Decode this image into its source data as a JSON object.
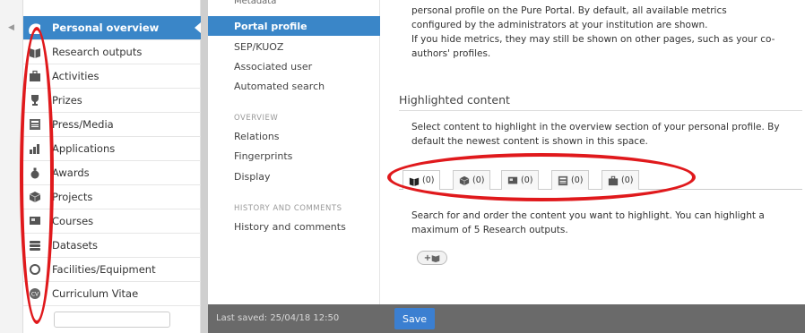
{
  "left_nav": {
    "items": [
      {
        "label": "Personal overview",
        "icon": "user-icon",
        "active": true
      },
      {
        "label": "Research outputs",
        "icon": "book-icon"
      },
      {
        "label": "Activities",
        "icon": "briefcase-icon"
      },
      {
        "label": "Prizes",
        "icon": "trophy-icon"
      },
      {
        "label": "Press/Media",
        "icon": "newspaper-icon"
      },
      {
        "label": "Applications",
        "icon": "bar-chart-icon"
      },
      {
        "label": "Awards",
        "icon": "money-bag-icon"
      },
      {
        "label": "Projects",
        "icon": "cube-icon"
      },
      {
        "label": "Courses",
        "icon": "presentation-icon"
      },
      {
        "label": "Datasets",
        "icon": "database-icon"
      },
      {
        "label": "Facilities/Equipment",
        "icon": "circle-icon"
      },
      {
        "label": "Curriculum Vitae",
        "icon": "cv-icon"
      }
    ]
  },
  "mid_nav": {
    "cut_top": "Metadata",
    "items": [
      {
        "label": "Portal profile",
        "active": true
      },
      {
        "label": "SEP/KUOZ"
      },
      {
        "label": "Associated user"
      },
      {
        "label": "Automated search"
      }
    ],
    "overview_heading": "OVERVIEW",
    "overview_items": [
      "Relations",
      "Fingerprints",
      "Display"
    ],
    "history_heading": "HISTORY AND COMMENTS",
    "history_items": [
      "History and comments"
    ]
  },
  "main": {
    "intro_lines": [
      "personal profile on the Pure Portal. By default, all available metrics",
      "configured by the administrators at your institution are shown.",
      "If you hide metrics, they may still be shown on other pages, such as your co-",
      "authors' profiles."
    ],
    "highlighted_title": "Highlighted content",
    "highlighted_desc_lines": [
      "Select content to highlight in the overview section of your personal profile. By",
      "default the newest content is shown in this space."
    ],
    "tabs": [
      {
        "icon": "book-icon",
        "count": "(0)"
      },
      {
        "icon": "cube-icon",
        "count": "(0)"
      },
      {
        "icon": "presentation-icon",
        "count": "(0)"
      },
      {
        "icon": "newspaper-icon",
        "count": "(0)"
      },
      {
        "icon": "briefcase-icon",
        "count": "(0)"
      }
    ],
    "search_desc_lines": [
      "Search for and order the content you want to highlight. You can highlight a",
      "maximum of 5 Research outputs."
    ],
    "add_button_label": "+"
  },
  "bottom_bar": {
    "saved_text": "Last saved: 25/04/18 12:50",
    "save_label": "Save"
  },
  "colors": {
    "accent": "#3a86c8",
    "annotation": "#e0191c",
    "bottom_bar": "#6a6a6a",
    "save_button": "#3b7fd1"
  }
}
